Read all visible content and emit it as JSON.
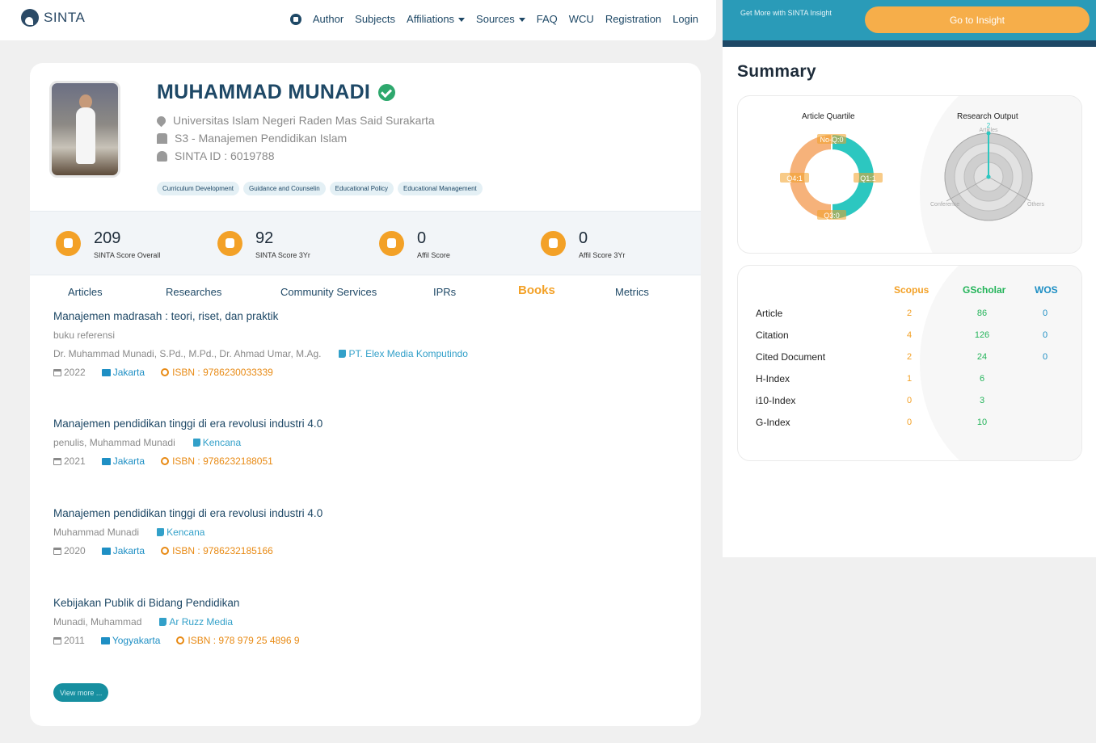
{
  "nav": {
    "brand": "SINTA",
    "links": [
      "Author",
      "Subjects",
      "Affiliations",
      "Sources",
      "FAQ",
      "WCU",
      "Registration",
      "Login"
    ]
  },
  "insight": {
    "text": "Get More with SINTA Insight",
    "button": "Go to Insight"
  },
  "profile": {
    "name": "MUHAMMAD MUNADI",
    "affiliation": "Universitas Islam Negeri Raden Mas Said Surakarta",
    "program": "S3 - Manajemen Pendidikan Islam",
    "sinta_id": "SINTA ID : 6019788",
    "tags": [
      "Curriculum Development",
      "Guidance and Counselin",
      "Educational Policy",
      "Educational Management"
    ]
  },
  "stats": [
    {
      "value": "209",
      "label": "SINTA Score Overall"
    },
    {
      "value": "92",
      "label": "SINTA Score 3Yr"
    },
    {
      "value": "0",
      "label": "Affil Score"
    },
    {
      "value": "0",
      "label": "Affil Score 3Yr"
    }
  ],
  "tabs": [
    "Articles",
    "Researches",
    "Community Services",
    "IPRs",
    "Books",
    "Metrics"
  ],
  "active_tab": "Books",
  "books": [
    {
      "title": "Manajemen madrasah : teori, riset, dan praktik",
      "type": "buku referensi",
      "authors": "Dr. Muhammad Munadi, S.Pd., M.Pd., Dr. Ahmad Umar, M.Ag.",
      "publisher": "PT. Elex Media Komputindo",
      "year": "2022",
      "city": "Jakarta",
      "isbn": "ISBN : 9786230033339"
    },
    {
      "title": "Manajemen pendidikan tinggi di era revolusi industri 4.0",
      "authors": "penulis, Muhammad Munadi",
      "publisher": "Kencana",
      "year": "2021",
      "city": "Jakarta",
      "isbn": "ISBN : 9786232188051"
    },
    {
      "title": "Manajemen pendidikan tinggi di era revolusi industri 4.0",
      "authors": "Muhammad Munadi",
      "publisher": "Kencana",
      "year": "2020",
      "city": "Jakarta",
      "isbn": "ISBN : 9786232185166"
    },
    {
      "title": "Kebijakan Publik di Bidang Pendidikan",
      "authors": "Munadi, Muhammad",
      "publisher": "Ar Ruzz Media",
      "year": "2011",
      "city": "Yogyakarta",
      "isbn": "ISBN : 978 979 25 4896 9"
    }
  ],
  "view_more": "View more ...",
  "summary": {
    "title": "Summary",
    "quartile_title": "Article Quartile",
    "quartile_labels": [
      "No-Q:0",
      "Q1:1",
      "Q3:0",
      "Q4:1"
    ],
    "output_title": "Research Output",
    "output_labels": [
      "Articles",
      "Conference",
      "Others"
    ],
    "output_tick": "2"
  },
  "metrics": {
    "columns": [
      "Scopus",
      "GScholar",
      "WOS"
    ],
    "rows": [
      {
        "label": "Article",
        "scopus": "2",
        "gscholar": "86",
        "wos": "0"
      },
      {
        "label": "Citation",
        "scopus": "4",
        "gscholar": "126",
        "wos": "0"
      },
      {
        "label": "Cited Document",
        "scopus": "2",
        "gscholar": "24",
        "wos": "0"
      },
      {
        "label": "H-Index",
        "scopus": "1",
        "gscholar": "6",
        "wos": ""
      },
      {
        "label": "i10-Index",
        "scopus": "0",
        "gscholar": "3",
        "wos": ""
      },
      {
        "label": "G-Index",
        "scopus": "0",
        "gscholar": "10",
        "wos": ""
      }
    ]
  },
  "chart_data": [
    {
      "type": "pie",
      "title": "Article Quartile",
      "categories": [
        "No-Q",
        "Q1",
        "Q3",
        "Q4"
      ],
      "values": [
        0,
        1,
        0,
        1
      ],
      "colors": [
        "#f3a127",
        "#2cc7c0",
        "#f3a127",
        "#f6b27a"
      ]
    },
    {
      "type": "radar",
      "title": "Research Output",
      "categories": [
        "Articles",
        "Conference",
        "Others"
      ],
      "values": [
        2,
        0,
        0
      ],
      "max": 2
    }
  ]
}
